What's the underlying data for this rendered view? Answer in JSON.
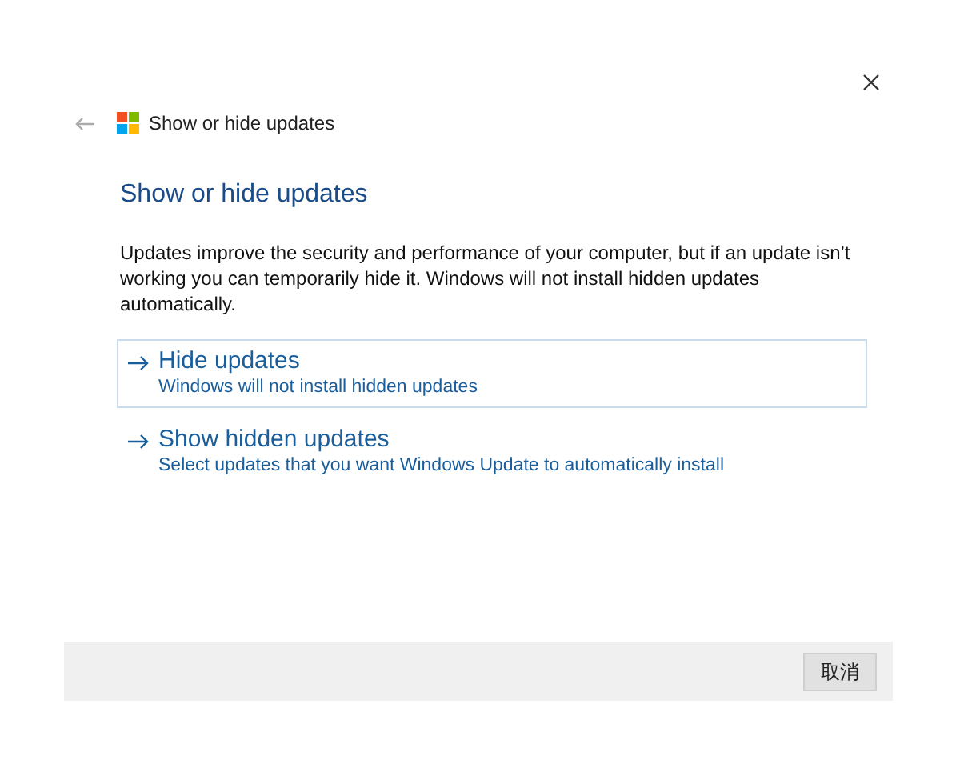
{
  "window": {
    "title": "Show or hide updates"
  },
  "heading": "Show or hide updates",
  "description": "Updates improve the security and performance of your computer, but if an update isn’t working you can temporarily hide it. Windows will not install hidden updates automatically.",
  "options": [
    {
      "title": "Hide updates",
      "subtitle": "Windows will not install hidden updates",
      "selected": true
    },
    {
      "title": "Show hidden updates",
      "subtitle": "Select updates that you want Windows Update to automatically install",
      "selected": false
    }
  ],
  "footer": {
    "buttons": [
      "取消"
    ]
  }
}
